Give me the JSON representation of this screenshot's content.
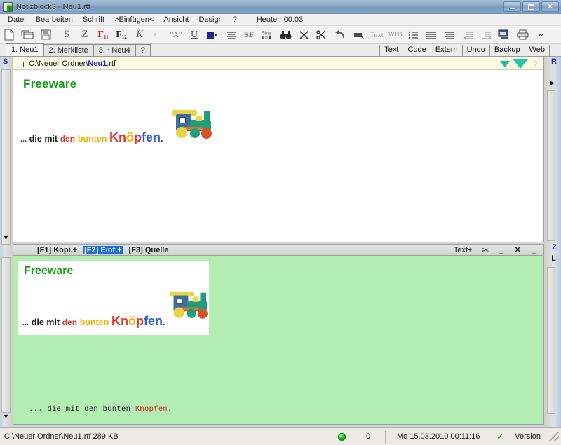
{
  "window": {
    "title": "Notizblock3 - Neu1.rtf",
    "icon": "notepad-icon",
    "buttons": {
      "minimize": "minimize-icon",
      "maximize": "maximize-icon",
      "close": "close-icon"
    }
  },
  "menubar": {
    "items": [
      {
        "label": "Datei",
        "name": "menu-datei"
      },
      {
        "label": "Bearbeiten",
        "name": "menu-bearbeiten"
      },
      {
        "label": "Schrift",
        "name": "menu-schrift"
      },
      {
        "label": ">Einfügen<",
        "name": "menu-einfuegen"
      },
      {
        "label": "Ansicht",
        "name": "menu-ansicht"
      },
      {
        "label": "Design",
        "name": "menu-design"
      },
      {
        "label": "?",
        "name": "menu-help"
      }
    ],
    "today": "Heute= 00:03"
  },
  "toolbar": {
    "buttons": [
      {
        "name": "new-document-icon",
        "glyph": "page"
      },
      {
        "name": "open-window-icon",
        "glyph": "window"
      },
      {
        "name": "save-icon",
        "glyph": "disk"
      },
      {
        "name": "strikethrough-icon",
        "glyph": "S"
      },
      {
        "name": "zeichen-icon",
        "glyph": "Z"
      },
      {
        "name": "font1-icon",
        "glyph": "F",
        "sub": "11",
        "color": "#d21a1a"
      },
      {
        "name": "font2-bold-icon",
        "glyph": "F",
        "sub": "12",
        "color": "#2b2b2b"
      },
      {
        "name": "italic-icon",
        "glyph": "K"
      },
      {
        "name": "small-caps-icon",
        "glyph": "AA"
      },
      {
        "name": "quote-icon",
        "glyph": "\"A\""
      },
      {
        "name": "underline-icon",
        "glyph": "U"
      },
      {
        "name": "color-picker-icon",
        "glyph": "colorbox"
      },
      {
        "name": "align-left-icon",
        "glyph": "lines"
      },
      {
        "name": "search-replace-icon",
        "glyph": "SF"
      },
      {
        "name": "strg-icon",
        "glyph": "Strg"
      },
      {
        "name": "binoculars-find-icon",
        "glyph": "binoculars"
      },
      {
        "name": "delete-x-icon",
        "glyph": "X"
      },
      {
        "name": "cut-scissors-icon",
        "glyph": "scissors"
      },
      {
        "name": "undo-icon",
        "glyph": "undo"
      },
      {
        "name": "insert-object-icon",
        "glyph": "block"
      },
      {
        "name": "text-icon",
        "glyph": "Text"
      },
      {
        "name": "web-icon",
        "glyph": "WEB"
      },
      {
        "name": "bullet-list-icon",
        "glyph": "bullets"
      },
      {
        "name": "align-justify-icon",
        "glyph": "justify"
      },
      {
        "name": "align-right-icon",
        "glyph": "alignright"
      },
      {
        "name": "indent-decrease-icon",
        "glyph": "outdent"
      },
      {
        "name": "indent-increase-icon",
        "glyph": "indent"
      },
      {
        "name": "screen-capture-icon",
        "glyph": "monitor"
      },
      {
        "name": "print-icon",
        "glyph": "printer"
      },
      {
        "name": "more-chevron-icon",
        "glyph": "»"
      }
    ]
  },
  "tabs": {
    "left": [
      {
        "label": "1. Neu1",
        "active": true
      },
      {
        "label": "2. Merkliste",
        "active": false
      },
      {
        "label": "3. ~Neu4",
        "active": false
      },
      {
        "label": "?",
        "active": false
      }
    ],
    "right": [
      {
        "label": "Text",
        "active": true
      },
      {
        "label": "Code",
        "active": false
      },
      {
        "label": "Extern",
        "active": false
      },
      {
        "label": "Undo",
        "active": false
      },
      {
        "label": "Backup",
        "active": false
      },
      {
        "label": "Web",
        "active": false
      }
    ]
  },
  "gutters": {
    "left_top_letter": "S",
    "right_top_letter": "R",
    "right_mid_letter": "Z",
    "right_low_letter": "L",
    "left_scroll_down": "▼",
    "right_play_arrow": "▶"
  },
  "document": {
    "path_prefix": "C:\\Neuer Ordner\\",
    "path_name": "Neu1",
    "path_ext": ".rtf",
    "heading": "Freeware",
    "caption": {
      "dots": "...",
      "black1": "die mit",
      "red1": "den",
      "orange1": "bunten",
      "big_K": "Kn",
      "big_oe": "ö",
      "big_p": "p",
      "big_fen": "fen",
      "period": "."
    },
    "image_alt": "toy-train-image",
    "marker_small": "green-triangle-small",
    "marker_large": "green-triangle-large",
    "question_mark": "?"
  },
  "splitbar": {
    "f1": "[F1] Kopi.+",
    "f2": "[F2] Einf.+",
    "f3": "[F3] Quelle",
    "text_plus": "Text+",
    "scissors": "✂",
    "minimize": "_",
    "close": "✕",
    "restore": "_"
  },
  "preview": {
    "heading": "Freeware",
    "mono_black": "... die mit den bunten ",
    "mono_red": "Knöpfen",
    "mono_end": "."
  },
  "statusbar": {
    "file_path": "C:\\Neuer Ordner\\Neu1.rtf  289 KB",
    "led": "green-led-icon",
    "counter": "0",
    "datetime": "Mo 15.03.2010 00:11:16",
    "check": "✓",
    "version_label": "Version"
  },
  "colors": {
    "green_heading": "#18a018",
    "red": "#e8332a",
    "orange": "#f5b301",
    "blue": "#2b5fd9",
    "pane_green": "#b2eeb2",
    "doc_header_yellow": "#fbfbe4",
    "tab_highlight": "#1a6ae0"
  }
}
